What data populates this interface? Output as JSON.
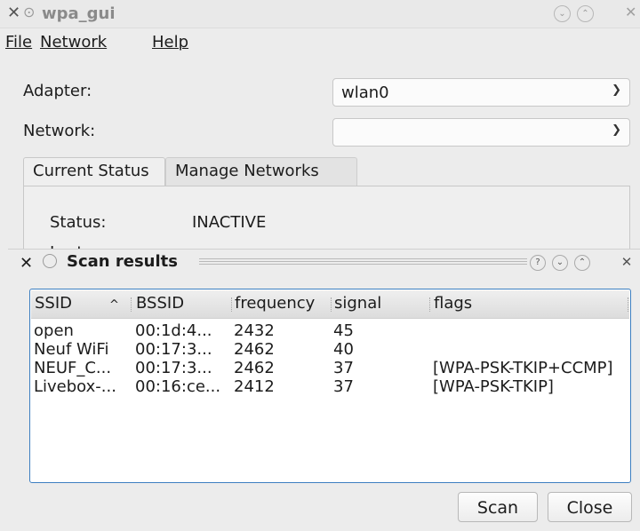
{
  "window": {
    "title": "wpa_gui",
    "close_glyph": "✕",
    "pin_glyph": "⊙",
    "minimize_glyph": "⌄",
    "maximize_glyph": "⌃"
  },
  "menu": [
    "File",
    "Network",
    "Help"
  ],
  "adapter": {
    "label": "Adapter:",
    "value": "wlan0"
  },
  "network": {
    "label": "Network:",
    "value": ""
  },
  "tabs": [
    {
      "label": "Current Status",
      "active": true
    },
    {
      "label": "Manage Networks",
      "active": false
    }
  ],
  "status": {
    "label": "Status:",
    "value": "INACTIVE",
    "last_message_label": "Last message:"
  },
  "scan_dialog": {
    "title": "Scan results",
    "help_glyph": "?",
    "columns": [
      "SSID",
      "BSSID",
      "frequency",
      "signal",
      "flags"
    ],
    "sort_indicator": "^",
    "rows": [
      {
        "ssid": "open",
        "bssid": "00:1d:4...",
        "frequency": "2432",
        "signal": "45",
        "flags": ""
      },
      {
        "ssid": "Neuf WiFi",
        "bssid": "00:17:3...",
        "frequency": "2462",
        "signal": "40",
        "flags": ""
      },
      {
        "ssid": "NEUF_C...",
        "bssid": "00:17:3...",
        "frequency": "2462",
        "signal": "37",
        "flags": "[WPA-PSK-TKIP+CCMP]"
      },
      {
        "ssid": "Livebox-...",
        "bssid": "00:16:ce...",
        "frequency": "2412",
        "signal": "37",
        "flags": "[WPA-PSK-TKIP]"
      }
    ],
    "scan_button": "Scan",
    "close_button": "Close"
  },
  "colors": {
    "focus_border": "#3d7fc1",
    "background": "#ececec"
  }
}
